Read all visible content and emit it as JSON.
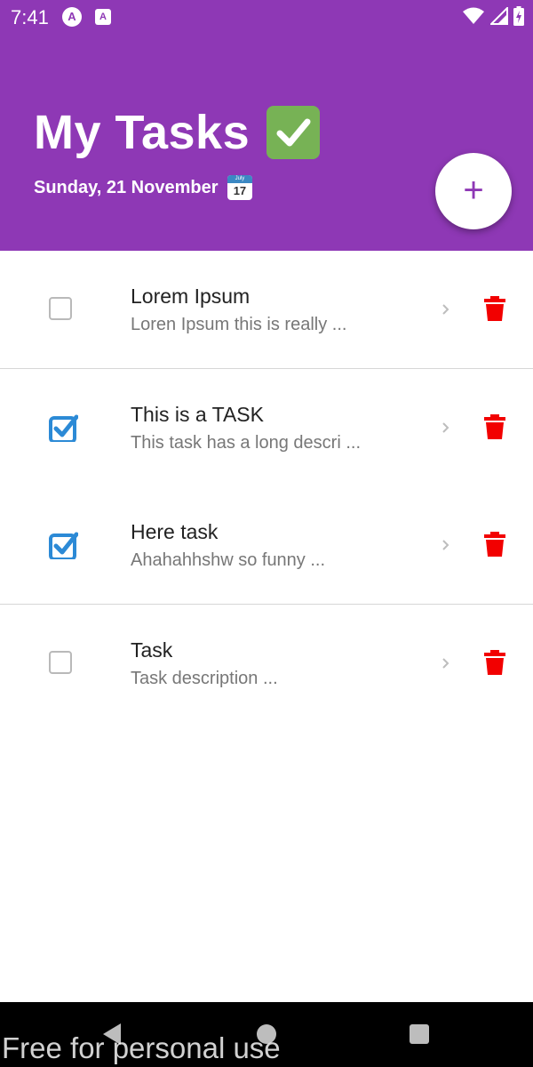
{
  "status_bar": {
    "time": "7:41",
    "icons": [
      "app-a-icon",
      "app-square-a-icon",
      "wifi-icon",
      "signal-icon",
      "battery-charging-icon"
    ]
  },
  "header": {
    "title": "My Tasks ✅",
    "title_text": "My Tasks",
    "date": "Sunday, 21 November",
    "calendar_icon": {
      "month": "July",
      "day": "17"
    },
    "add_button_label": "+"
  },
  "colors": {
    "header_bg": "#8e38b5",
    "checkbox_checked": "#2c8ad6",
    "trash": "#f20000",
    "text_primary": "#222222",
    "text_secondary": "#777777"
  },
  "tasks": [
    {
      "title": "Lorem Ipsum",
      "description": "Loren Ipsum this is really  ...",
      "completed": false
    },
    {
      "title": "This is a TASK",
      "description": "This task has a long descri ...",
      "completed": true
    },
    {
      "title": "Here task",
      "description": "Ahahahhshw so funny ...",
      "completed": true
    },
    {
      "title": "Task",
      "description": "Task description ...",
      "completed": false
    }
  ],
  "nav_bar": {
    "icons": [
      "back-icon",
      "home-icon",
      "recents-icon"
    ]
  },
  "watermark": "Free for personal use"
}
